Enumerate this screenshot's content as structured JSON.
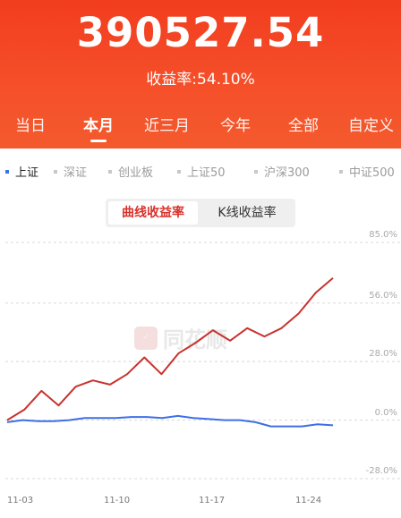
{
  "header": {
    "total_amount": "390527.54",
    "return_rate": "收益率:54.10%"
  },
  "tabs": [
    "当日",
    "本月",
    "近三月",
    "今年",
    "全部",
    "自定义"
  ],
  "active_tab": "本月",
  "indices": [
    "上证",
    "深证",
    "创业板",
    "上证50",
    "沪深300",
    "中证500"
  ],
  "active_index": "上证",
  "chart_toggle": {
    "selected": "曲线收益率",
    "other": "K线收益率"
  },
  "watermark": "同花顺",
  "chart_data": {
    "type": "line",
    "y_tick_labels": [
      "85.0%",
      "56.0%",
      "28.0%",
      "0.0%",
      "-28.0%"
    ],
    "x_tick_labels": [
      "11-03",
      "11-10",
      "11-17",
      "11-24"
    ],
    "ylim": [
      -28,
      85
    ],
    "series": [
      {
        "color": "#c8322d",
        "values": [
          0,
          5,
          14,
          7,
          16,
          19,
          17,
          22,
          30,
          22,
          32,
          37,
          43,
          38,
          44,
          40,
          44,
          51,
          61,
          68
        ]
      },
      {
        "color": "#3d6fe6",
        "values": [
          -1,
          0,
          -0.5,
          -0.5,
          0,
          1,
          1,
          1,
          1.5,
          1.5,
          1,
          2,
          1,
          0.5,
          0,
          0,
          -1,
          -3,
          -3,
          -3,
          -2,
          -2.5
        ]
      }
    ]
  }
}
